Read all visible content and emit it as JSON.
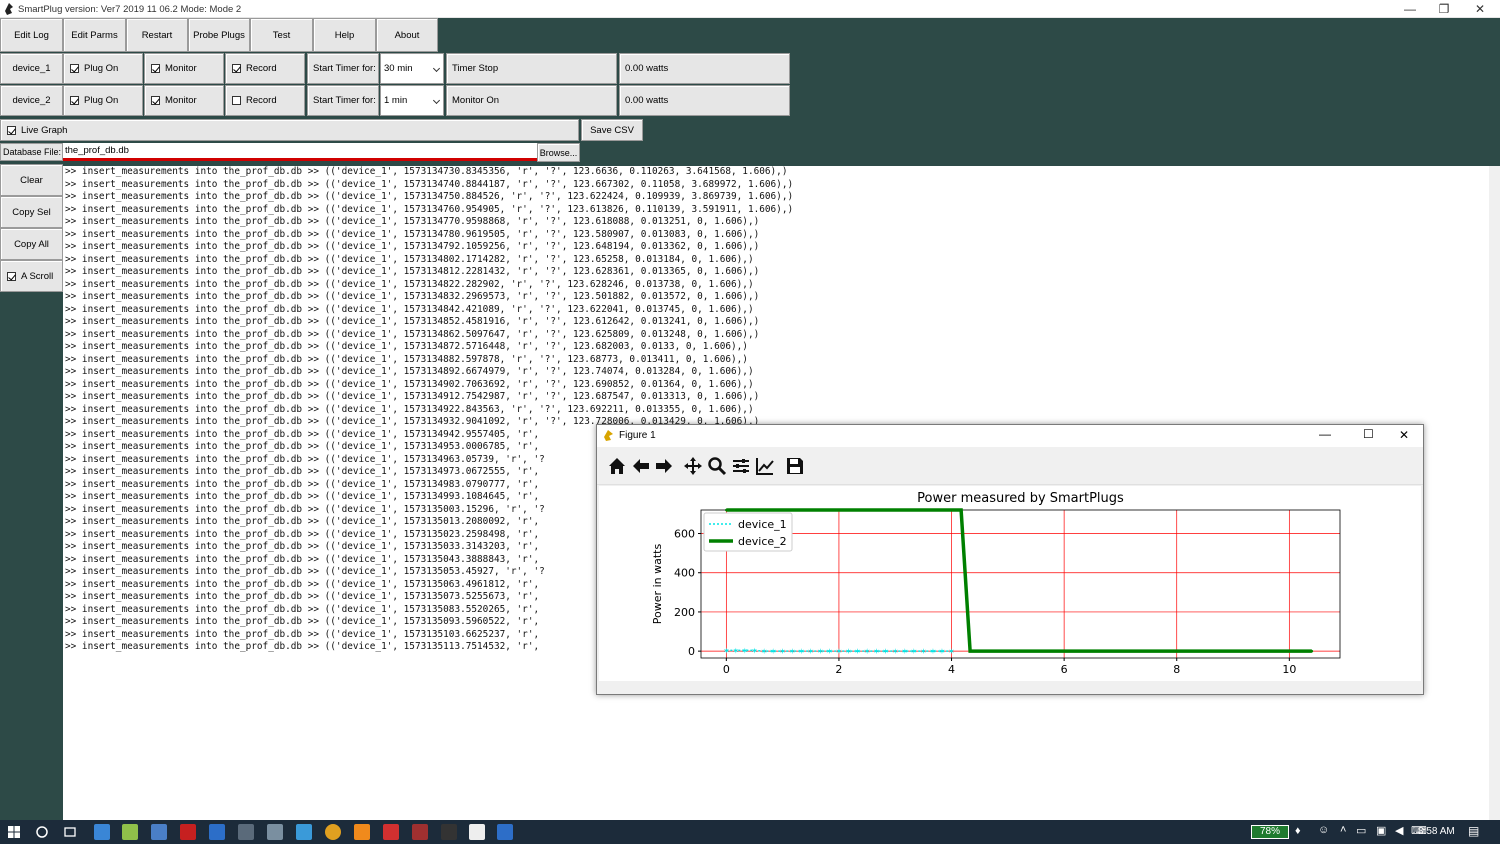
{
  "window": {
    "title": "SmartPlug version: Ver7 2019 11 06.2 Mode: Mode 2",
    "min": "—",
    "max": "❐",
    "close": "✕"
  },
  "menu": [
    "Edit Log",
    "Edit Parms",
    "Restart",
    "Probe Plugs",
    "Test",
    "Help",
    "About"
  ],
  "devices": [
    {
      "name": "device_1",
      "plug_on": "Plug On",
      "plug_on_checked": true,
      "monitor": "Monitor",
      "monitor_checked": true,
      "record": "Record",
      "record_checked": true,
      "timer_label": "Start Timer for:",
      "timer_value": "30 min",
      "status": "Timer Stop",
      "power": "0.00 watts"
    },
    {
      "name": "device_2",
      "plug_on": "Plug On",
      "plug_on_checked": true,
      "monitor": "Monitor",
      "monitor_checked": true,
      "record": "Record",
      "record_checked": false,
      "timer_label": "Start Timer for:",
      "timer_value": "1 min",
      "status": "Monitor On",
      "power": "0.00 watts"
    }
  ],
  "live_graph": {
    "label": "Live Graph",
    "checked": true
  },
  "save_csv": "Save CSV",
  "database": {
    "label": "Database File:",
    "value": "the_prof_db.db",
    "browse": "Browse..."
  },
  "side_buttons": [
    "Clear",
    "Copy Sel",
    "Copy All"
  ],
  "auto_scroll": {
    "label": "A Scroll",
    "checked": true
  },
  "log_lines": [
    ">> insert_measurements into the_prof_db.db >> (('device_1', 1573134730.8345356, 'r', '?', 123.6636, 0.110263, 3.641568, 1.606),)",
    ">> insert_measurements into the_prof_db.db >> (('device_1', 1573134740.8844187, 'r', '?', 123.667302, 0.11058, 3.689972, 1.606),)",
    ">> insert_measurements into the_prof_db.db >> (('device_1', 1573134750.884526, 'r', '?', 123.622424, 0.109939, 3.869739, 1.606),)",
    ">> insert_measurements into the_prof_db.db >> (('device_1', 1573134760.954905, 'r', '?', 123.613826, 0.110139, 3.591911, 1.606),)",
    ">> insert_measurements into the_prof_db.db >> (('device_1', 1573134770.9598868, 'r', '?', 123.618088, 0.013251, 0, 1.606),)",
    ">> insert_measurements into the_prof_db.db >> (('device_1', 1573134780.9619505, 'r', '?', 123.580907, 0.013083, 0, 1.606),)",
    ">> insert_measurements into the_prof_db.db >> (('device_1', 1573134792.1059256, 'r', '?', 123.648194, 0.013362, 0, 1.606),)",
    ">> insert_measurements into the_prof_db.db >> (('device_1', 1573134802.1714282, 'r', '?', 123.65258, 0.013184, 0, 1.606),)",
    ">> insert_measurements into the_prof_db.db >> (('device_1', 1573134812.2281432, 'r', '?', 123.628361, 0.013365, 0, 1.606),)",
    ">> insert_measurements into the_prof_db.db >> (('device_1', 1573134822.282902, 'r', '?', 123.628246, 0.013738, 0, 1.606),)",
    ">> insert_measurements into the_prof_db.db >> (('device_1', 1573134832.2969573, 'r', '?', 123.501882, 0.013572, 0, 1.606),)",
    ">> insert_measurements into the_prof_db.db >> (('device_1', 1573134842.421089, 'r', '?', 123.622041, 0.013745, 0, 1.606),)",
    ">> insert_measurements into the_prof_db.db >> (('device_1', 1573134852.4581916, 'r', '?', 123.612642, 0.013241, 0, 1.606),)",
    ">> insert_measurements into the_prof_db.db >> (('device_1', 1573134862.5097647, 'r', '?', 123.625809, 0.013248, 0, 1.606),)",
    ">> insert_measurements into the_prof_db.db >> (('device_1', 1573134872.5716448, 'r', '?', 123.682003, 0.0133, 0, 1.606),)",
    ">> insert_measurements into the_prof_db.db >> (('device_1', 1573134882.597878, 'r', '?', 123.68773, 0.013411, 0, 1.606),)",
    ">> insert_measurements into the_prof_db.db >> (('device_1', 1573134892.6674979, 'r', '?', 123.74074, 0.013284, 0, 1.606),)",
    ">> insert_measurements into the_prof_db.db >> (('device_1', 1573134902.7063692, 'r', '?', 123.690852, 0.01364, 0, 1.606),)",
    ">> insert_measurements into the_prof_db.db >> (('device_1', 1573134912.7542987, 'r', '?', 123.687547, 0.013313, 0, 1.606),)",
    ">> insert_measurements into the_prof_db.db >> (('device_1', 1573134922.843563, 'r', '?', 123.692211, 0.013355, 0, 1.606),)",
    ">> insert_measurements into the_prof_db.db >> (('device_1', 1573134932.9041092, 'r', '?', 123.728006, 0.013429, 0, 1.606),)",
    ">> insert_measurements into the_prof_db.db >> (('device_1', 1573134942.9557405, 'r',",
    ">> insert_measurements into the_prof_db.db >> (('device_1', 1573134953.0006785, 'r',",
    ">> insert_measurements into the_prof_db.db >> (('device_1', 1573134963.05739, 'r', '?",
    ">> insert_measurements into the_prof_db.db >> (('device_1', 1573134973.0672555, 'r',",
    ">> insert_measurements into the_prof_db.db >> (('device_1', 1573134983.0790777, 'r',",
    ">> insert_measurements into the_prof_db.db >> (('device_1', 1573134993.1084645, 'r',",
    ">> insert_measurements into the_prof_db.db >> (('device_1', 1573135003.15296, 'r', '?",
    ">> insert_measurements into the_prof_db.db >> (('device_1', 1573135013.2080092, 'r',",
    ">> insert_measurements into the_prof_db.db >> (('device_1', 1573135023.2598498, 'r',",
    ">> insert_measurements into the_prof_db.db >> (('device_1', 1573135033.3143203, 'r',",
    ">> insert_measurements into the_prof_db.db >> (('device_1', 1573135043.3888843, 'r',",
    ">> insert_measurements into the_prof_db.db >> (('device_1', 1573135053.45927, 'r', '?",
    ">> insert_measurements into the_prof_db.db >> (('device_1', 1573135063.4961812, 'r',",
    ">> insert_measurements into the_prof_db.db >> (('device_1', 1573135073.5255673, 'r',",
    ">> insert_measurements into the_prof_db.db >> (('device_1', 1573135083.5520265, 'r',",
    ">> insert_measurements into the_prof_db.db >> (('device_1', 1573135093.5960522, 'r',",
    ">> insert_measurements into the_prof_db.db >> (('device_1', 1573135103.6625237, 'r',",
    ">> insert_measurements into the_prof_db.db >> (('device_1', 1573135113.7514532, 'r',"
  ],
  "figure": {
    "title": "Figure 1",
    "min": "—",
    "max": "☐",
    "close": "✕",
    "tools": [
      "home-icon",
      "back-arrow-icon",
      "forward-arrow-icon",
      "pan-icon",
      "zoom-icon",
      "configure-subplots-icon",
      "edit-axis-icon",
      "save-icon"
    ]
  },
  "taskbar": {
    "battery": "78%",
    "time": "8:58 AM"
  },
  "chart_data": {
    "type": "line",
    "title": "Power measured by SmartPlugs",
    "xlabel": "",
    "ylabel": "Power in watts",
    "xlim": [
      -0.45,
      10.9
    ],
    "ylim": [
      -35,
      720
    ],
    "xticks": [
      0,
      2,
      4,
      6,
      8,
      10
    ],
    "yticks": [
      0,
      200,
      400,
      600
    ],
    "grid": true,
    "grid_color": "#ff0000",
    "legend_position": "upper-left",
    "series": [
      {
        "name": "device_1",
        "color": "#00e5e5",
        "style": "dotted-star",
        "x": [
          0,
          0.17,
          0.33,
          0.5,
          0.67,
          0.83,
          1,
          1.17,
          1.33,
          1.5,
          1.67,
          1.83,
          2,
          2.17,
          2.33,
          2.5,
          2.67,
          2.83,
          3,
          3.17,
          3.33,
          3.5,
          3.67,
          3.83,
          4.0
        ],
        "y": [
          3.6,
          3.7,
          3.9,
          3.6,
          0,
          0,
          0,
          0,
          0,
          0,
          0,
          0,
          0,
          0,
          0,
          0,
          0,
          0,
          0,
          0,
          0,
          0,
          0,
          0,
          0
        ]
      },
      {
        "name": "device_2",
        "color": "#008000",
        "style": "solid-marker",
        "x": [
          0,
          0.17,
          0.33,
          0.5,
          0.67,
          0.83,
          1,
          1.17,
          1.33,
          1.5,
          1.67,
          1.83,
          2,
          2.17,
          2.33,
          2.5,
          2.67,
          2.83,
          3,
          3.17,
          3.33,
          3.5,
          3.67,
          3.83,
          4.0,
          4.17,
          4.33,
          4.5,
          4.67,
          4.83,
          5,
          5.17,
          5.33,
          5.5,
          5.67,
          5.83,
          6,
          6.17,
          6.33,
          6.5,
          6.67,
          6.83,
          7,
          7.17,
          7.33,
          7.5,
          7.67,
          7.83,
          8,
          8.17,
          8.33,
          8.5,
          8.67,
          8.83,
          9,
          9.17,
          9.33,
          9.5,
          9.67,
          9.83,
          10,
          10.17,
          10.33,
          10.4
        ],
        "y": [
          720,
          720,
          720,
          720,
          720,
          720,
          720,
          720,
          720,
          720,
          720,
          720,
          720,
          720,
          720,
          720,
          720,
          720,
          720,
          720,
          720,
          720,
          720,
          720,
          720,
          720,
          0,
          0,
          0,
          0,
          0,
          0,
          0,
          0,
          0,
          0,
          0,
          0,
          0,
          0,
          0,
          0,
          0,
          0,
          0,
          0,
          0,
          0,
          0,
          0,
          0,
          0,
          0,
          0,
          0,
          0,
          0,
          0,
          0,
          0,
          0,
          0,
          0,
          0
        ]
      }
    ]
  }
}
